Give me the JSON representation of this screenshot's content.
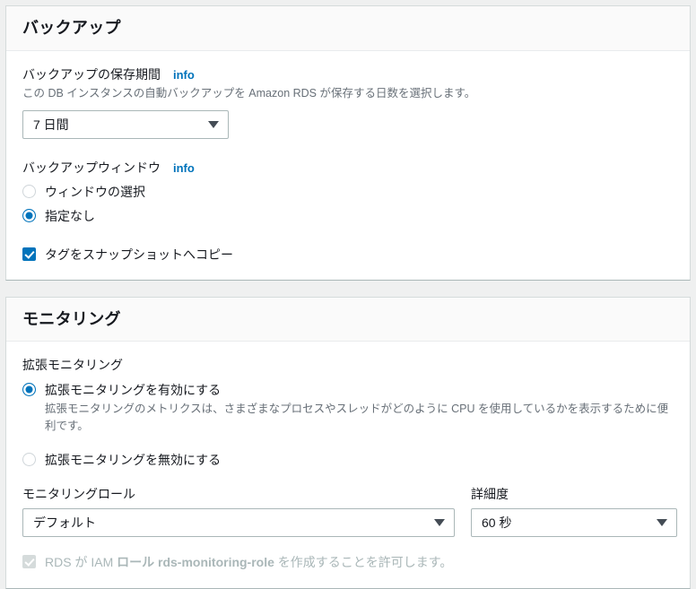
{
  "backup_panel": {
    "title": "バックアップ",
    "retention": {
      "label": "バックアップの保存期間",
      "info_label": "info",
      "description": "この DB インスタンスの自動バックアップを Amazon RDS が保存する日数を選択します。",
      "selected_value": "7 日間"
    },
    "window": {
      "label": "バックアップウィンドウ",
      "info_label": "info",
      "options": [
        {
          "label": "ウィンドウの選択",
          "selected": false
        },
        {
          "label": "指定なし",
          "selected": true
        }
      ]
    },
    "copy_tags": {
      "label": "タグをスナップショットへコピー",
      "checked": true
    }
  },
  "monitoring_panel": {
    "title": "モニタリング",
    "enhanced": {
      "label": "拡張モニタリング",
      "options": [
        {
          "label": "拡張モニタリングを有効にする",
          "selected": true,
          "description": "拡張モニタリングのメトリクスは、さまざまなプロセスやスレッドがどのように CPU を使用しているかを表示するために便利です。"
        },
        {
          "label": "拡張モニタリングを無効にする",
          "selected": false,
          "description": ""
        }
      ]
    },
    "monitoring_role": {
      "label": "モニタリングロール",
      "selected_value": "デフォルト"
    },
    "granularity": {
      "label": "詳細度",
      "selected_value": "60 秒"
    },
    "iam_permission": {
      "text_before": "RDS が IAM ",
      "text_role": "ロール rds-monitoring-role ",
      "text_after": "を作成することを許可します。",
      "checked": true,
      "disabled": true
    }
  },
  "colors": {
    "accent": "#0073bb",
    "page_background": "#eff0f0",
    "panel_background": "#ffffff",
    "muted_text": "#687078",
    "disabled_text": "#aab7b8"
  }
}
